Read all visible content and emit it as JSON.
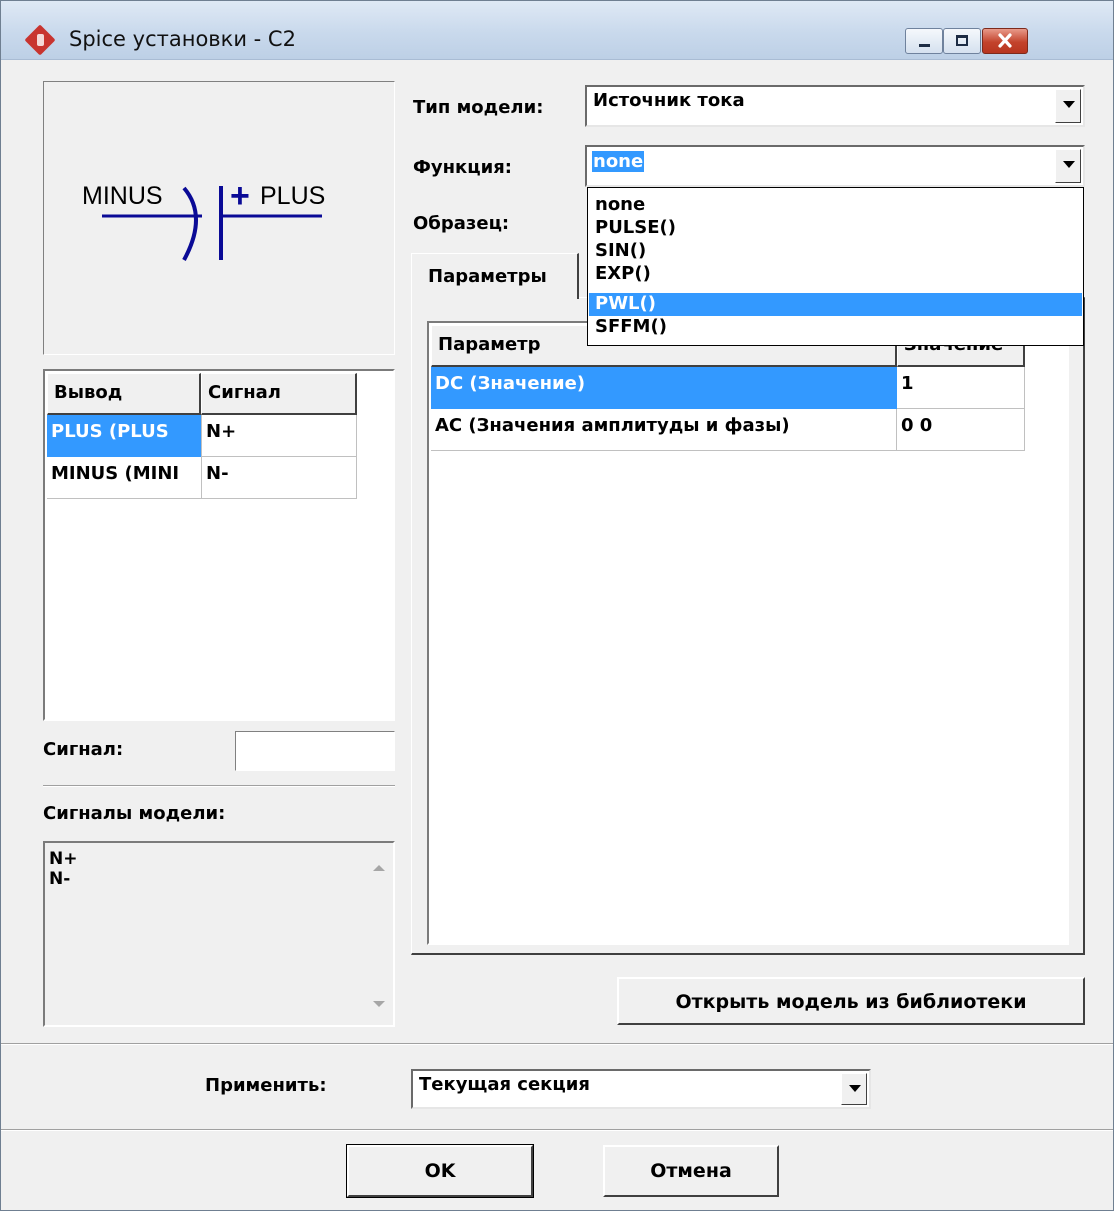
{
  "window": {
    "title": "Spice установки - C2"
  },
  "preview": {
    "left_label": "MINUS",
    "right_label": "PLUS",
    "plus_sign": "+",
    "stroke_color": "#0a0a96"
  },
  "pin_table": {
    "headers": [
      "Вывод",
      "Сигнал"
    ],
    "rows": [
      {
        "pin": "PLUS (PLUS",
        "signal": "N+",
        "selected": true
      },
      {
        "pin": "MINUS (MINI",
        "signal": "N-",
        "selected": false
      }
    ]
  },
  "signal_field": {
    "label": "Сигнал:",
    "value": ""
  },
  "model_signals": {
    "label": "Сигналы модели:",
    "items": [
      "N+",
      "N-"
    ]
  },
  "model_type": {
    "label": "Тип модели:",
    "value": "Источник тока"
  },
  "function": {
    "label": "Функция:",
    "value": "none",
    "options": [
      "none",
      "PULSE()",
      "SIN()",
      "EXP()",
      "PWL()",
      "SFFM()"
    ],
    "highlighted": "PWL()"
  },
  "sample": {
    "label": "Образец:"
  },
  "tabs": {
    "active": "Параметры"
  },
  "params_table": {
    "headers": [
      "Параметр",
      "Значение"
    ],
    "rows": [
      {
        "name": "DC (Значение)",
        "value": "1",
        "selected": true
      },
      {
        "name": "AC (Значения амплитуды и фазы)",
        "value": "0 0",
        "selected": false
      }
    ]
  },
  "open_library_button": "Открыть модель из библиотеки",
  "apply": {
    "label": "Применить:",
    "value": "Текущая секция"
  },
  "buttons": {
    "ok": "OK",
    "cancel": "Отмена"
  },
  "colors": {
    "selection": "#3399ff",
    "face": "#f0f0f0"
  }
}
